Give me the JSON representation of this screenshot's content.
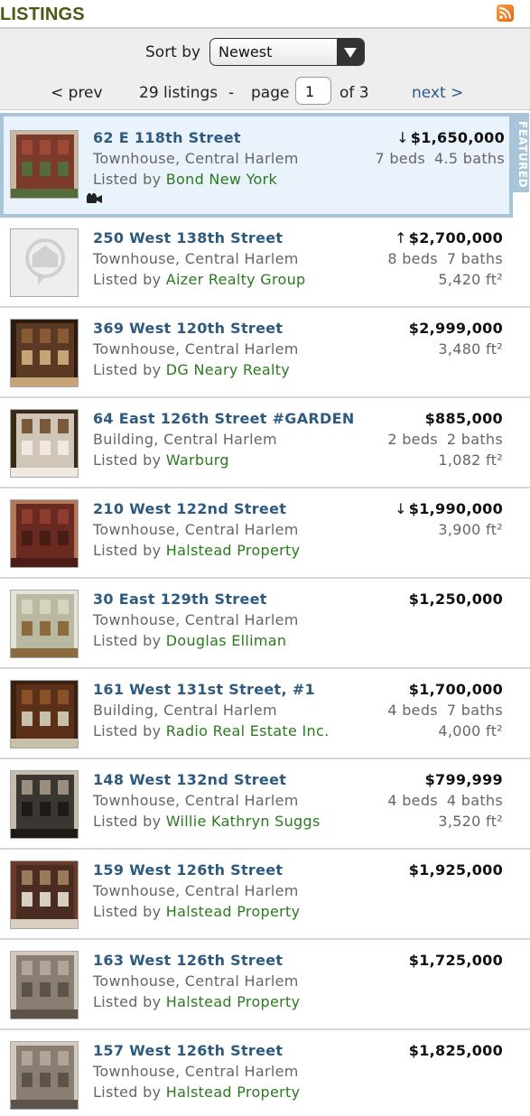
{
  "header": {
    "title": "LISTINGS",
    "rss_icon": "rss-icon"
  },
  "controls": {
    "sort_label": "Sort by",
    "sort_value": "Newest",
    "prev_label": "< prev",
    "count_label": "29 listings",
    "separator": "-",
    "page_label": "page",
    "page_value": "1",
    "of_label": "of 3",
    "next_label": "next >"
  },
  "featured_tab": "FEATURED",
  "listings": [
    {
      "address": "62 E 118th Street",
      "type": "Townhouse, Central Harlem",
      "listed_by": "Listed by",
      "broker": "Bond New York",
      "arrow": "↓",
      "price": "$1,650,000",
      "beds": "7 beds",
      "baths": "4.5 baths",
      "sqft": "",
      "featured": true
    },
    {
      "address": "250 West 138th Street",
      "type": "Townhouse, Central Harlem",
      "listed_by": "Listed by",
      "broker": "Aizer Realty Group",
      "arrow": "↑",
      "price": "$2,700,000",
      "beds": "8 beds",
      "baths": "7 baths",
      "sqft": "5,420 ft²"
    },
    {
      "address": "369 West 120th Street",
      "type": "Townhouse, Central Harlem",
      "listed_by": "Listed by",
      "broker": "DG Neary Realty",
      "arrow": "",
      "price": "$2,999,000",
      "beds": "",
      "baths": "",
      "sqft": "3,480 ft²"
    },
    {
      "address": "64 East 126th Street #GARDEN",
      "type": "Building, Central Harlem",
      "listed_by": "Listed by",
      "broker": "Warburg",
      "arrow": "",
      "price": "$885,000",
      "beds": "2 beds",
      "baths": "2 baths",
      "sqft": "1,082 ft²"
    },
    {
      "address": "210 West 122nd Street",
      "type": "Townhouse, Central Harlem",
      "listed_by": "Listed by",
      "broker": "Halstead Property",
      "arrow": "↓",
      "price": "$1,990,000",
      "beds": "",
      "baths": "",
      "sqft": "3,900 ft²"
    },
    {
      "address": "30 East 129th Street",
      "type": "Townhouse, Central Harlem",
      "listed_by": "Listed by",
      "broker": "Douglas Elliman",
      "arrow": "",
      "price": "$1,250,000",
      "beds": "",
      "baths": "",
      "sqft": ""
    },
    {
      "address": "161 West 131st Street, #1",
      "type": "Building, Central Harlem",
      "listed_by": "Listed by",
      "broker": "Radio Real Estate Inc.",
      "arrow": "",
      "price": "$1,700,000",
      "beds": "4 beds",
      "baths": "7 baths",
      "sqft": "4,000 ft²"
    },
    {
      "address": "148 West 132nd Street",
      "type": "Townhouse, Central Harlem",
      "listed_by": "Listed by",
      "broker": "Willie Kathryn Suggs",
      "arrow": "",
      "price": "$799,999",
      "beds": "4 beds",
      "baths": "4 baths",
      "sqft": "3,520 ft²"
    },
    {
      "address": "159 West 126th Street",
      "type": "Townhouse, Central Harlem",
      "listed_by": "Listed by",
      "broker": "Halstead Property",
      "arrow": "",
      "price": "$1,925,000",
      "beds": "",
      "baths": "",
      "sqft": ""
    },
    {
      "address": "163 West 126th Street",
      "type": "Townhouse, Central Harlem",
      "listed_by": "Listed by",
      "broker": "Halstead Property",
      "arrow": "",
      "price": "$1,725,000",
      "beds": "",
      "baths": "",
      "sqft": ""
    },
    {
      "address": "157 West 126th Street",
      "type": "Townhouse, Central Harlem",
      "listed_by": "Listed by",
      "broker": "Halstead Property",
      "arrow": "",
      "price": "$1,825,000",
      "beds": "",
      "baths": "",
      "sqft": ""
    }
  ]
}
